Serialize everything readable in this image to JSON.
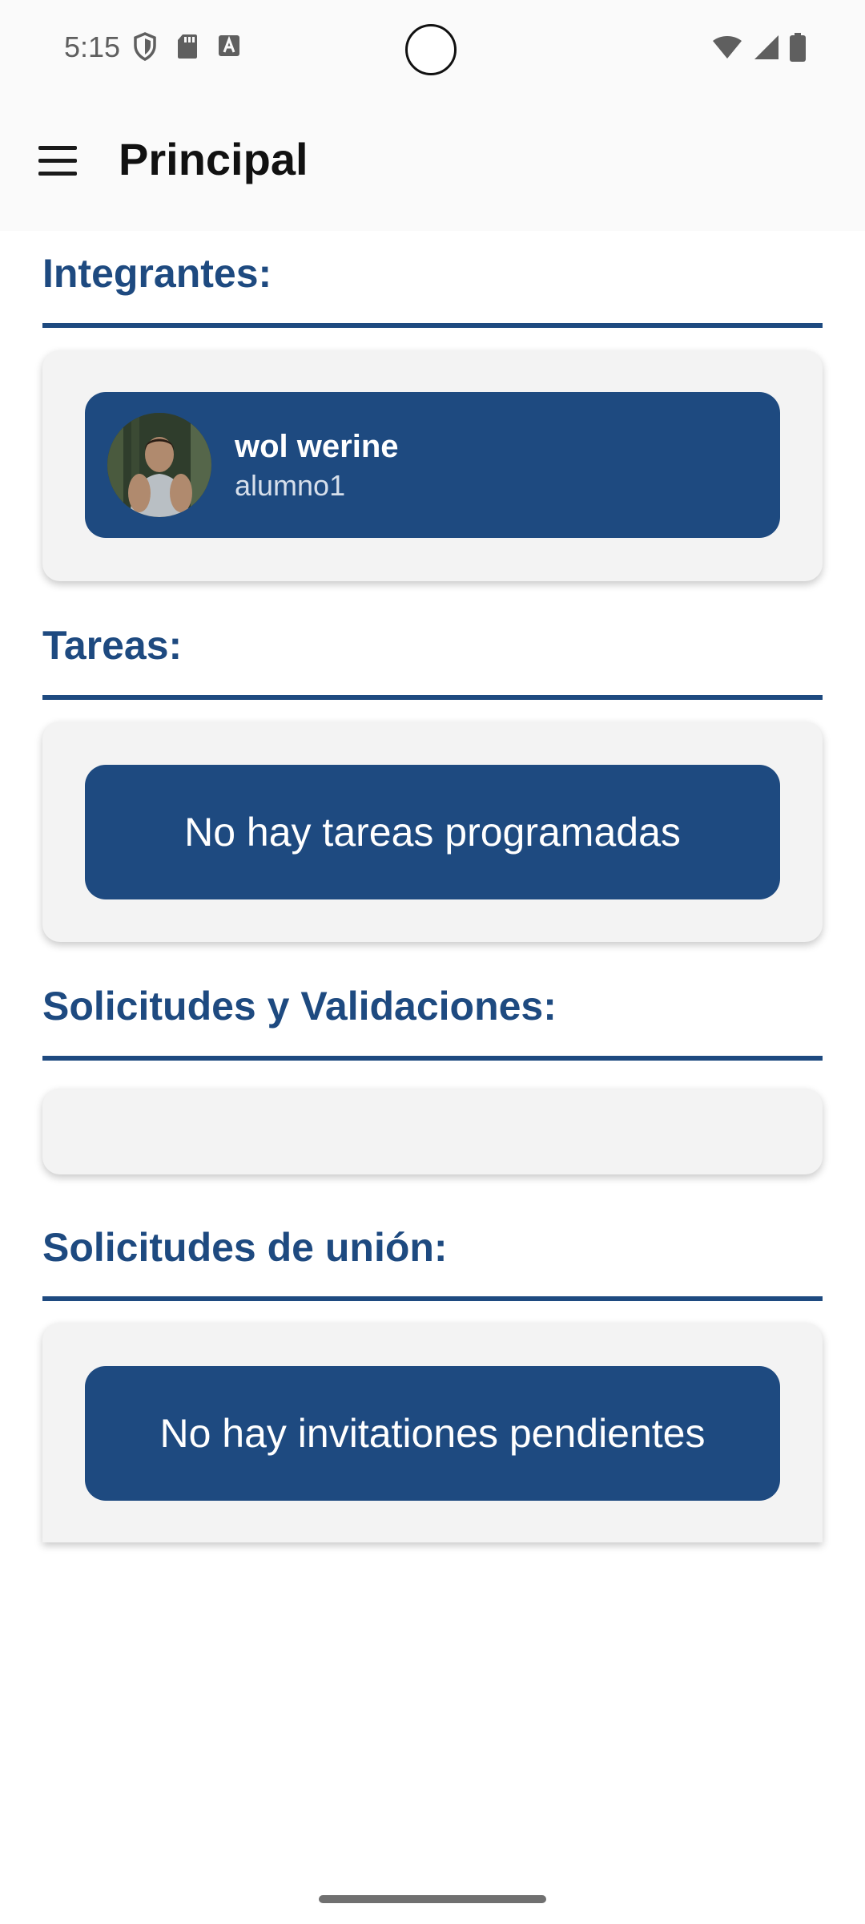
{
  "status_bar": {
    "time": "5:15",
    "icons_left": [
      "shield-icon",
      "sd-card-icon",
      "font-a-icon"
    ],
    "icons_right": [
      "wifi-icon",
      "signal-icon",
      "battery-icon"
    ]
  },
  "app_bar": {
    "title": "Principal",
    "menu_icon": "menu-icon"
  },
  "sections": {
    "integrantes": {
      "title": "Integrantes:",
      "members": [
        {
          "name": "wol werine",
          "username": "alumno1"
        }
      ]
    },
    "tareas": {
      "title": "Tareas:",
      "empty_message": "No hay tareas programadas"
    },
    "solicitudes_validaciones": {
      "title": "Solicitudes y Validaciones:"
    },
    "solicitudes_union": {
      "title": "Solicitudes de unión:",
      "empty_message": "No hay invitationes pendientes"
    }
  },
  "colors": {
    "accent": "#1e4a80",
    "card_background": "#f3f3f3",
    "app_bar_background": "#fafafa"
  }
}
